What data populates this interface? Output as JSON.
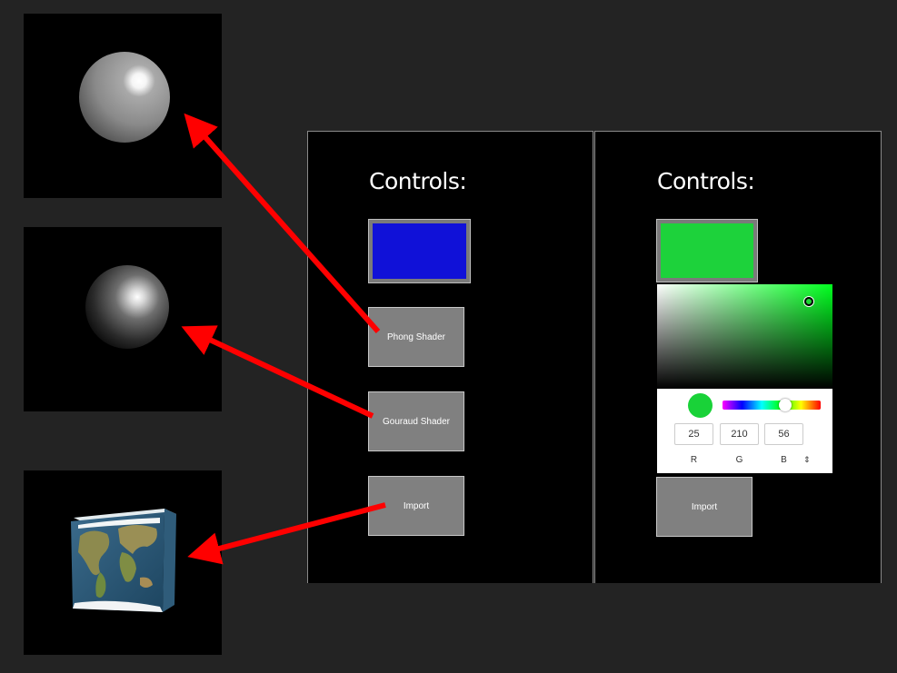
{
  "left_panel": {
    "title": "Controls:",
    "swatch_color": "#1011d8",
    "buttons": {
      "phong": "Phong Shader",
      "gouraud": "Gouraud Shader",
      "import": "Import"
    }
  },
  "right_panel": {
    "title": "Controls:",
    "swatch_color": "#1dd23b",
    "color_picker": {
      "r": "25",
      "g": "210",
      "b": "56",
      "r_label": "R",
      "g_label": "G",
      "b_label": "B",
      "current_color": "#19d238"
    },
    "import_label": "Import"
  },
  "colors": {
    "background": "#232323",
    "arrow": "#ff0000",
    "button": "#808080"
  }
}
